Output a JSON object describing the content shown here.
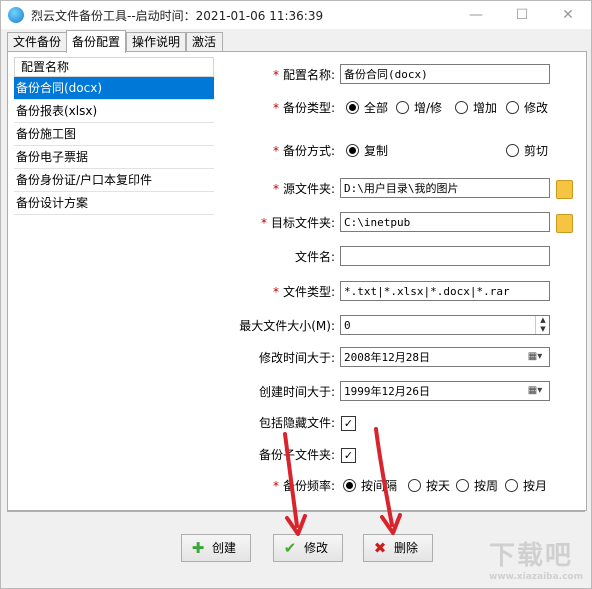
{
  "window": {
    "title": "烈云文件备份工具--启动时间：2021-01-06 11:36:39",
    "minimize": "—",
    "maximize": "☐",
    "close": "✕"
  },
  "tabs": [
    "文件备份",
    "备份配置",
    "操作说明",
    "激活"
  ],
  "list": {
    "header": "配置名称",
    "items": [
      "备份合同(docx)",
      "备份报表(xlsx)",
      "备份施工图",
      "备份电子票据",
      "备份身份证/户口本复印件",
      "备份设计方案"
    ]
  },
  "form": {
    "config_name_label": "配置名称:",
    "config_name_value": "备份合同(docx)",
    "backup_type_label": "备份类型:",
    "backup_type_options": [
      "全部",
      "增/修",
      "增加",
      "修改"
    ],
    "backup_mode_label": "备份方式:",
    "backup_mode_options": [
      "复制",
      "剪切"
    ],
    "source_label": "源文件夹:",
    "source_value": "D:\\用户目录\\我的图片",
    "target_label": "目标文件夹:",
    "target_value": "C:\\inetpub",
    "filename_label": "文件名:",
    "filename_value": "",
    "filetype_label": "文件类型:",
    "filetype_value": "*.txt|*.xlsx|*.docx|*.rar",
    "maxsize_label": "最大文件大小(M):",
    "maxsize_value": "0",
    "modified_label": "修改时间大于:",
    "modified_value": "2008年12月28日",
    "created_label": "创建时间大于:",
    "created_value": "1999年12月26日",
    "hidden_label": "包括隐藏文件:",
    "subfolder_label": "备份子文件夹:",
    "frequency_label": "备份频率:",
    "frequency_options": [
      "按间隔",
      "按天",
      "按周",
      "按月"
    ]
  },
  "buttons": {
    "create": "创建",
    "modify": "修改",
    "delete": "删除"
  },
  "watermark": {
    "text": "下载吧",
    "url": "www.xiazaiba.com"
  },
  "colors": {
    "selection": "#0078d7",
    "required": "#c00000",
    "arrow": "#d9232d"
  }
}
